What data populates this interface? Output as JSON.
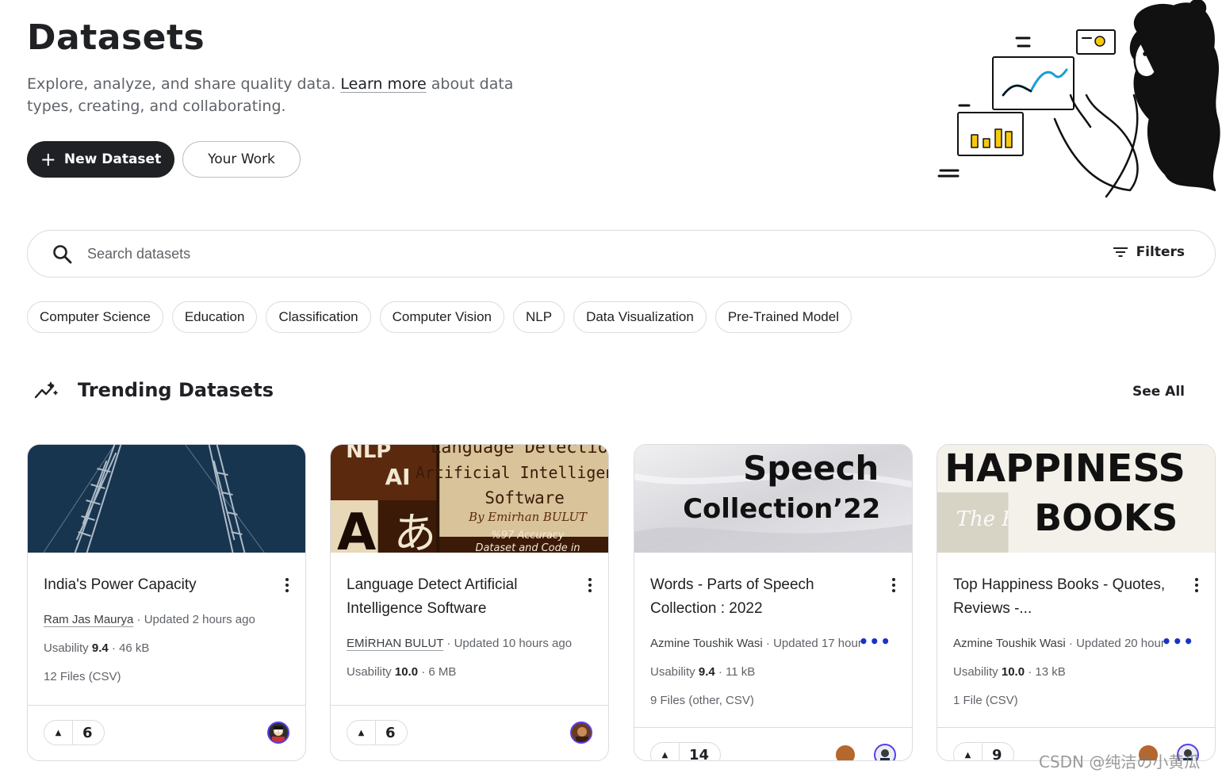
{
  "header": {
    "title": "Datasets",
    "intro_before": "Explore, analyze, and share quality data. ",
    "intro_link": "Learn more",
    "intro_after": " about data types, creating, and collaborating.",
    "new_dataset_label": "New Dataset",
    "your_work_label": "Your Work"
  },
  "search": {
    "placeholder": "Search datasets",
    "filters_label": "Filters"
  },
  "chips": [
    "Computer Science",
    "Education",
    "Classification",
    "Computer Vision",
    "NLP",
    "Data Visualization",
    "Pre-Trained Model"
  ],
  "trending": {
    "title": "Trending Datasets",
    "see_all": "See All"
  },
  "cards": [
    {
      "title": "India's Power Capacity",
      "author": "Ram Jas Maurya",
      "updated": "Updated 2 hours ago",
      "usability_label": "Usability",
      "usability": "9.4",
      "size": "46 kB",
      "files": "12 Files (CSV)",
      "votes": "6"
    },
    {
      "title": "Language Detect Artificial Intelligence Software",
      "author": "EMİRHAN BULUT",
      "updated": "Updated 10 hours ago",
      "usability_label": "Usability",
      "usability": "10.0",
      "size": "6 MB",
      "files": "",
      "votes": "6",
      "thumb_text": [
        "NLP",
        "AI",
        "Language Detection",
        "Artificial Intelligence",
        "Software",
        "By Emirhan BULUT",
        "%97 Accuracy",
        "Dataset and Code in",
        "A",
        "あ"
      ]
    },
    {
      "title": "Words - Parts of Speech Collection : 2022",
      "author": "Azmine Toushik Wasi",
      "updated": "Updated 17 hour",
      "usability_label": "Usability",
      "usability": "9.4",
      "size": "11 kB",
      "files": "9 Files (other, CSV)",
      "votes": "14",
      "thumb_text": [
        "Speech",
        "Collection’22"
      ]
    },
    {
      "title": "Top Happiness Books - Quotes, Reviews -...",
      "author": "Azmine Toushik Wasi",
      "updated": "Updated 20 hour",
      "usability_label": "Usability",
      "usability": "10.0",
      "size": "13 kB",
      "files": "1 File (CSV)",
      "votes": "9",
      "thumb_text": [
        "HAPPINESS",
        "BOOKS",
        "The H"
      ]
    }
  ],
  "watermark": "CSDN @纯洁の小黄瓜",
  "colors": {
    "primary_dark": "#202124",
    "border": "#dadce0",
    "muted_text": "#5f6368",
    "more_dots": "#1a33c7",
    "avatar_ring": "#5b3ee8"
  }
}
